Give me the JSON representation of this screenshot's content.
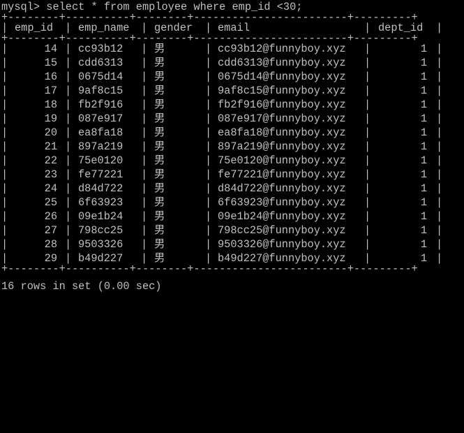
{
  "terminal": {
    "prompt": "mysql> ",
    "command": "select * from employee where emp_id <30;",
    "separator": "+--------+----------+--------+------------------------+---------+",
    "columns": [
      "emp_id",
      "emp_name",
      "gender",
      "email",
      "dept_id"
    ],
    "rows": [
      {
        "emp_id": "14",
        "emp_name": "cc93b12",
        "gender": "男",
        "email": "cc93b12@funnyboy.xyz",
        "dept_id": "1"
      },
      {
        "emp_id": "15",
        "emp_name": "cdd6313",
        "gender": "男",
        "email": "cdd6313@funnyboy.xyz",
        "dept_id": "1"
      },
      {
        "emp_id": "16",
        "emp_name": "0675d14",
        "gender": "男",
        "email": "0675d14@funnyboy.xyz",
        "dept_id": "1"
      },
      {
        "emp_id": "17",
        "emp_name": "9af8c15",
        "gender": "男",
        "email": "9af8c15@funnyboy.xyz",
        "dept_id": "1"
      },
      {
        "emp_id": "18",
        "emp_name": "fb2f916",
        "gender": "男",
        "email": "fb2f916@funnyboy.xyz",
        "dept_id": "1"
      },
      {
        "emp_id": "19",
        "emp_name": "087e917",
        "gender": "男",
        "email": "087e917@funnyboy.xyz",
        "dept_id": "1"
      },
      {
        "emp_id": "20",
        "emp_name": "ea8fa18",
        "gender": "男",
        "email": "ea8fa18@funnyboy.xyz",
        "dept_id": "1"
      },
      {
        "emp_id": "21",
        "emp_name": "897a219",
        "gender": "男",
        "email": "897a219@funnyboy.xyz",
        "dept_id": "1"
      },
      {
        "emp_id": "22",
        "emp_name": "75e0120",
        "gender": "男",
        "email": "75e0120@funnyboy.xyz",
        "dept_id": "1"
      },
      {
        "emp_id": "23",
        "emp_name": "fe77221",
        "gender": "男",
        "email": "fe77221@funnyboy.xyz",
        "dept_id": "1"
      },
      {
        "emp_id": "24",
        "emp_name": "d84d722",
        "gender": "男",
        "email": "d84d722@funnyboy.xyz",
        "dept_id": "1"
      },
      {
        "emp_id": "25",
        "emp_name": "6f63923",
        "gender": "男",
        "email": "6f63923@funnyboy.xyz",
        "dept_id": "1"
      },
      {
        "emp_id": "26",
        "emp_name": "09e1b24",
        "gender": "男",
        "email": "09e1b24@funnyboy.xyz",
        "dept_id": "1"
      },
      {
        "emp_id": "27",
        "emp_name": "798cc25",
        "gender": "男",
        "email": "798cc25@funnyboy.xyz",
        "dept_id": "1"
      },
      {
        "emp_id": "28",
        "emp_name": "9503326",
        "gender": "男",
        "email": "9503326@funnyboy.xyz",
        "dept_id": "1"
      },
      {
        "emp_id": "29",
        "emp_name": "b49d227",
        "gender": "男",
        "email": "b49d227@funnyboy.xyz",
        "dept_id": "1"
      }
    ],
    "result_summary": "16 rows in set (0.00 sec)"
  },
  "colors": {
    "background": "#000000",
    "text": "#c0c0c0"
  }
}
